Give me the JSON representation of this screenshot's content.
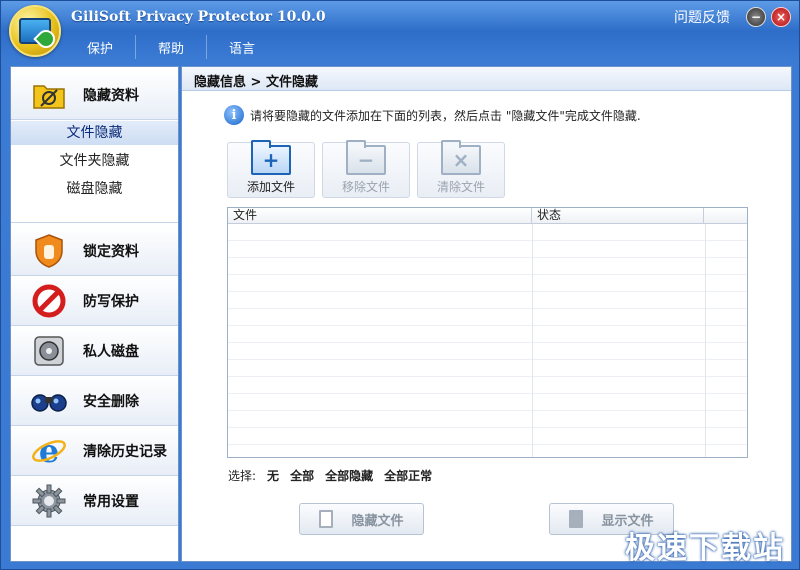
{
  "app": {
    "title": "GiliSoft Privacy Protector 10.0.0",
    "feedback": "问题反馈"
  },
  "window_controls": {
    "minimize": "−",
    "close": "×"
  },
  "menu": {
    "items": [
      "保护",
      "帮助",
      "语言"
    ]
  },
  "sidebar": {
    "sections": [
      {
        "label": "隐藏资料",
        "icon": "folder-hide-icon"
      },
      {
        "label": "锁定资料",
        "icon": "shield-hand-icon"
      },
      {
        "label": "防写保护",
        "icon": "no-entry-icon"
      },
      {
        "label": "私人磁盘",
        "icon": "safe-disk-icon"
      },
      {
        "label": "安全删除",
        "icon": "binoculars-icon"
      },
      {
        "label": "清除历史记录",
        "icon": "ie-browser-icon"
      },
      {
        "label": "常用设置",
        "icon": "gear-icon"
      }
    ],
    "sub_items": [
      "文件隐藏",
      "文件夹隐藏",
      "磁盘隐藏"
    ],
    "active_sub": "文件隐藏"
  },
  "main": {
    "breadcrumb": "隐藏信息 > 文件隐藏",
    "hint": "请将要隐藏的文件添加在下面的列表，然后点击 \"隐藏文件\"完成文件隐藏.",
    "toolbar": {
      "add": "添加文件",
      "remove": "移除文件",
      "clear": "清除文件"
    },
    "table": {
      "columns": [
        "文件",
        "状态"
      ]
    },
    "select": {
      "label": "选择:",
      "options": [
        "无",
        "全部",
        "全部隐藏",
        "全部正常"
      ]
    },
    "buttons": {
      "hide": "隐藏文件",
      "show": "显示文件"
    }
  },
  "watermark": "极速下载站",
  "colors": {
    "titlebar": "#2e6ec9",
    "accent": "#1e64b6",
    "panel_border": "#6d93c8"
  }
}
